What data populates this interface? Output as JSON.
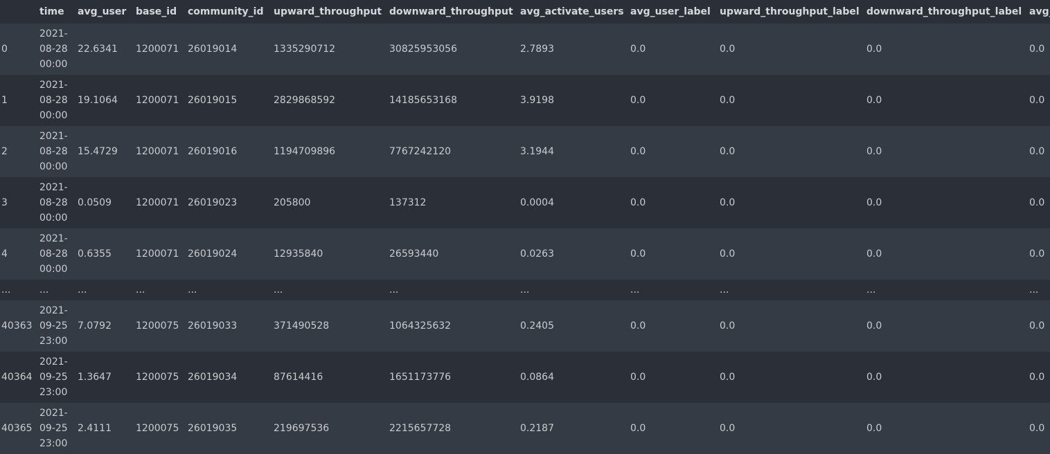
{
  "columns": [
    "",
    "time",
    "avg_user",
    "base_id",
    "community_id",
    "upward_throughput",
    "downward_throughput",
    "avg_activate_users",
    "avg_user_label",
    "upward_throughput_label",
    "downward_throughput_label",
    "avg_"
  ],
  "rows": [
    {
      "index": "0",
      "time": [
        "2021-",
        "08-28",
        "00:00"
      ],
      "avg_user": "22.6341",
      "base_id": "1200071",
      "community_id": "26019014",
      "upward_throughput": "1335290712",
      "downward_throughput": "30825953056",
      "avg_activate_users": "2.7893",
      "avg_user_label": "0.0",
      "upward_throughput_label": "0.0",
      "downward_throughput_label": "0.0",
      "avg_": "0.0"
    },
    {
      "index": "1",
      "time": [
        "2021-",
        "08-28",
        "00:00"
      ],
      "avg_user": "19.1064",
      "base_id": "1200071",
      "community_id": "26019015",
      "upward_throughput": "2829868592",
      "downward_throughput": "14185653168",
      "avg_activate_users": "3.9198",
      "avg_user_label": "0.0",
      "upward_throughput_label": "0.0",
      "downward_throughput_label": "0.0",
      "avg_": "0.0"
    },
    {
      "index": "2",
      "time": [
        "2021-",
        "08-28",
        "00:00"
      ],
      "avg_user": "15.4729",
      "base_id": "1200071",
      "community_id": "26019016",
      "upward_throughput": "1194709896",
      "downward_throughput": "7767242120",
      "avg_activate_users": "3.1944",
      "avg_user_label": "0.0",
      "upward_throughput_label": "0.0",
      "downward_throughput_label": "0.0",
      "avg_": "0.0"
    },
    {
      "index": "3",
      "time": [
        "2021-",
        "08-28",
        "00:00"
      ],
      "avg_user": "0.0509",
      "base_id": "1200071",
      "community_id": "26019023",
      "upward_throughput": "205800",
      "downward_throughput": "137312",
      "avg_activate_users": "0.0004",
      "avg_user_label": "0.0",
      "upward_throughput_label": "0.0",
      "downward_throughput_label": "0.0",
      "avg_": "0.0"
    },
    {
      "index": "4",
      "time": [
        "2021-",
        "08-28",
        "00:00"
      ],
      "avg_user": "0.6355",
      "base_id": "1200071",
      "community_id": "26019024",
      "upward_throughput": "12935840",
      "downward_throughput": "26593440",
      "avg_activate_users": "0.0263",
      "avg_user_label": "0.0",
      "upward_throughput_label": "0.0",
      "downward_throughput_label": "0.0",
      "avg_": "0.0"
    },
    {
      "ellipsis": true,
      "index": "...",
      "time": [
        "..."
      ],
      "avg_user": "...",
      "base_id": "...",
      "community_id": "...",
      "upward_throughput": "...",
      "downward_throughput": "...",
      "avg_activate_users": "...",
      "avg_user_label": "...",
      "upward_throughput_label": "...",
      "downward_throughput_label": "...",
      "avg_": "..."
    },
    {
      "index": "40363",
      "time": [
        "2021-",
        "09-25",
        "23:00"
      ],
      "avg_user": "7.0792",
      "base_id": "1200075",
      "community_id": "26019033",
      "upward_throughput": "371490528",
      "downward_throughput": "1064325632",
      "avg_activate_users": "0.2405",
      "avg_user_label": "0.0",
      "upward_throughput_label": "0.0",
      "downward_throughput_label": "0.0",
      "avg_": "0.0"
    },
    {
      "index": "40364",
      "time": [
        "2021-",
        "09-25",
        "23:00"
      ],
      "avg_user": "1.3647",
      "base_id": "1200075",
      "community_id": "26019034",
      "upward_throughput": "87614416",
      "downward_throughput": "1651173776",
      "avg_activate_users": "0.0864",
      "avg_user_label": "0.0",
      "upward_throughput_label": "0.0",
      "downward_throughput_label": "0.0",
      "avg_": "0.0"
    },
    {
      "index": "40365",
      "time": [
        "2021-",
        "09-25",
        "23:00"
      ],
      "avg_user": "2.4111",
      "base_id": "1200075",
      "community_id": "26019035",
      "upward_throughput": "219697536",
      "downward_throughput": "2215657728",
      "avg_activate_users": "0.2187",
      "avg_user_label": "0.0",
      "upward_throughput_label": "0.0",
      "downward_throughput_label": "0.0",
      "avg_": "0.0"
    }
  ]
}
